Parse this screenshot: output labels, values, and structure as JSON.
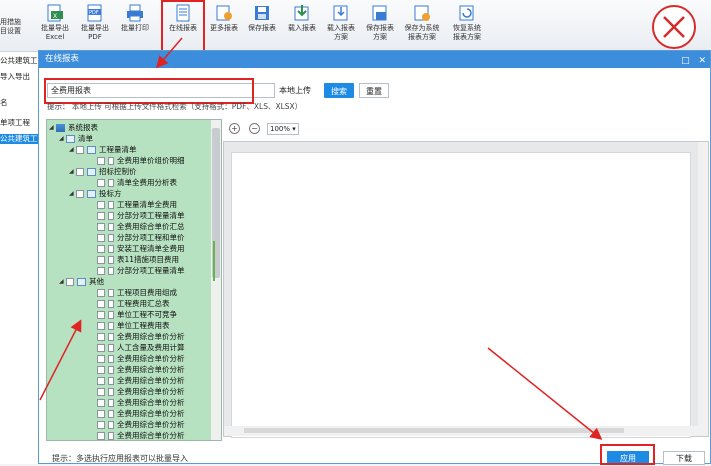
{
  "colors": {
    "accent": "#1d8be4",
    "annotation": "#e02323",
    "tree_bg": "#b7e2c1",
    "title_bar": "#3c8ddb"
  },
  "toolbar": {
    "cut_label_line1": "用措施",
    "cut_label_line2": "目设置",
    "items": [
      {
        "icon": "export-excel-icon",
        "line1": "批量导出",
        "line2": "Excel"
      },
      {
        "icon": "export-pdf-icon",
        "line1": "批量导出",
        "line2": "PDF"
      },
      {
        "icon": "print-icon",
        "line1": "批量打印",
        "line2": ""
      },
      {
        "icon": "online-report-icon",
        "line1": "在线报表",
        "line2": ""
      },
      {
        "icon": "more-reports-icon",
        "line1": "更多报表",
        "line2": ""
      },
      {
        "icon": "save-report-icon",
        "line1": "保存报表",
        "line2": ""
      },
      {
        "icon": "load-report-icon",
        "line1": "载入报表",
        "line2": ""
      },
      {
        "icon": "load-scheme-icon",
        "line1": "载入报表",
        "line2": "方案"
      },
      {
        "icon": "save-scheme-icon",
        "line1": "保存报表",
        "line2": "方案"
      },
      {
        "icon": "save-system-scheme-icon",
        "line1": "保存为系统",
        "line2": "报表方案"
      },
      {
        "icon": "restore-system-scheme-icon",
        "line1": "恢复系统",
        "line2": "报表方案"
      }
    ]
  },
  "left_strip": {
    "items": [
      "公共建筑工",
      "导入导出",
      "名",
      "单项工程",
      "公共建筑工"
    ]
  },
  "dialog": {
    "title": "在线报表",
    "search_value": "全费用报表",
    "local_upload": "本地上传",
    "search_button": "搜索",
    "reset_button": "重置",
    "hint_top": "提示：  本地上传  可根据上传文件格式检索（支持格式：PDF、XLS、XLSX）",
    "zoom": "100%",
    "hint_bottom": "提示：多选执行应用报表可以批量导入",
    "apply_button": "应用",
    "download_button": "下载"
  },
  "tree": {
    "root": "系统报表",
    "groups": [
      {
        "name": "清单",
        "children": [
          {
            "name": "工程量清单",
            "children": [
              "全费用单价组价明细"
            ]
          },
          {
            "name": "招标控制价",
            "children": [
              "清单全费用分析表"
            ]
          },
          {
            "name": "投标方",
            "children": [
              "工程量清单全费用",
              "分部分项工程量清单",
              "全费用综合单价汇总",
              "分部分项工程和单价",
              "安装工程清单全费用",
              "表11措施项目费用",
              "分部分项工程量清单"
            ]
          }
        ]
      },
      {
        "name": "其他",
        "children": [
          {
            "name": "",
            "children": [
              "工程项目费用组成",
              "工程费用汇总表",
              "单位工程不可竞争",
              "单位工程费用表",
              "全费用综合单价分析",
              "人工含量及费用计算",
              "全费用综合单价分析",
              "全费用综合单价分析",
              "全费用综合单价分析",
              "全费用综合单价分析",
              "全费用综合单价分析",
              "全费用综合单价分析",
              "全费用综合单价分析",
              "全费用综合单价分析"
            ]
          }
        ]
      }
    ]
  }
}
